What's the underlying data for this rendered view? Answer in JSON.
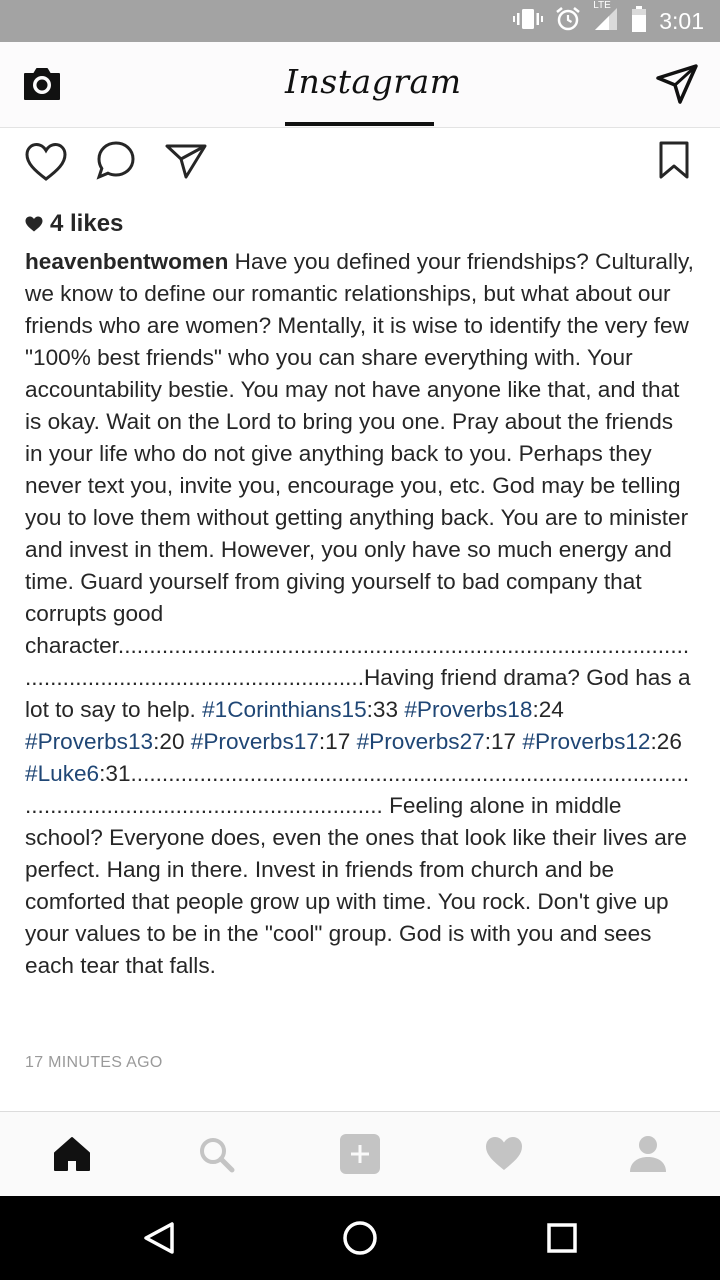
{
  "status_bar": {
    "network": "LTE",
    "time": "3:01"
  },
  "header": {
    "title": "Instagram"
  },
  "post": {
    "likes": "4 likes",
    "username": "heavenbentwomen",
    "caption_segments": [
      {
        "type": "text",
        "text": " Have you defined your friendships? Culturally, we know to define our romantic relationships, but what about our friends who are women? Mentally, it is wise to identify the very few \"100% best friends\" who you can share everything with. Your accountability bestie. You may not have anyone like that, and that is okay. Wait on the Lord to bring you one. Pray about the friends in your life who do not give anything back to you. Perhaps they never text you, invite you, encourage you, etc. God may be telling you to love them without getting anything back. You are to minister and invest in them. However, you only have so much energy and time. Guard yourself from giving yourself to bad company that corrupts good \ncharacter.................................................................................................................................................Having friend drama? God has a lot to say to help. "
      },
      {
        "type": "tag",
        "text": "#1Corinthians15"
      },
      {
        "type": "text",
        "text": ":33 "
      },
      {
        "type": "tag",
        "text": "#Proverbs18"
      },
      {
        "type": "text",
        "text": ":24 "
      },
      {
        "type": "tag",
        "text": "#Proverbs13"
      },
      {
        "type": "text",
        "text": ":20 "
      },
      {
        "type": "tag",
        "text": "#Proverbs17"
      },
      {
        "type": "text",
        "text": ":17 "
      },
      {
        "type": "tag",
        "text": "#Proverbs27"
      },
      {
        "type": "text",
        "text": ":17 "
      },
      {
        "type": "tag",
        "text": "#Proverbs12"
      },
      {
        "type": "text",
        "text": ":26\n"
      },
      {
        "type": "tag",
        "text": "#Luke6"
      },
      {
        "type": "text",
        "text": ":31.................................................................................................................................................. Feeling alone in middle school? Everyone does, even the ones that look like their lives are perfect. Hang in there. Invest in friends from church and be comforted that people grow up with time. You rock. Don't give up your values to be in the \"cool\" group. God is with you and sees each tear that falls."
      }
    ],
    "timestamp": "17 MINUTES AGO"
  },
  "tab_bar": {
    "items": [
      "home-icon",
      "search-icon",
      "add-icon",
      "heart-icon",
      "profile-icon"
    ],
    "active": "home-icon"
  },
  "colors": {
    "hashtag": "#1f4675",
    "status_bar": "#a3a3a3",
    "text": "#262626"
  }
}
